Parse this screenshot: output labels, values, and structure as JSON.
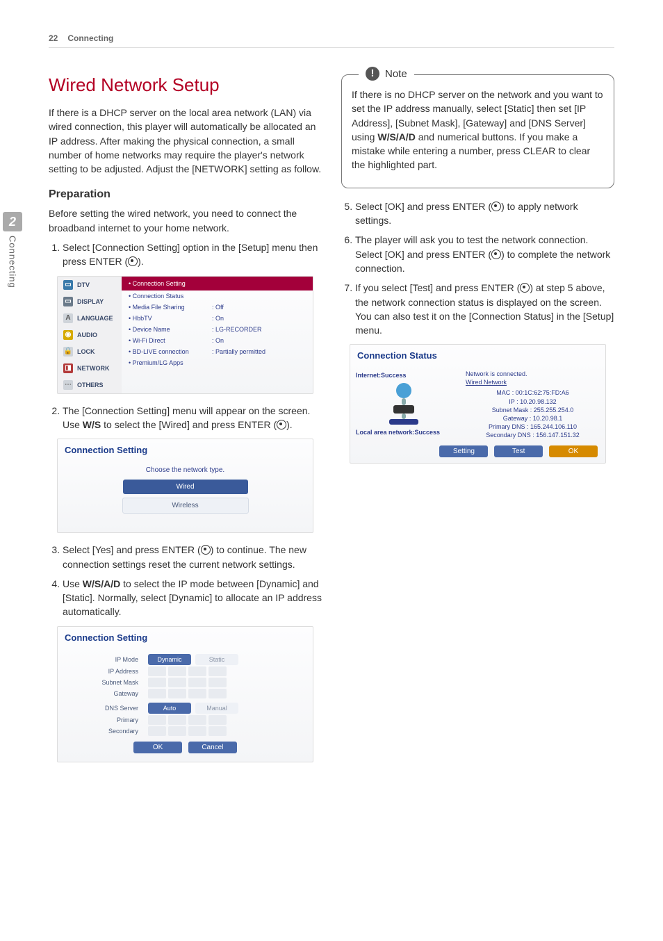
{
  "header": {
    "page_number": "22",
    "section": "Connecting"
  },
  "side_tab": {
    "number": "2",
    "label": "Connecting"
  },
  "left": {
    "title": "Wired Network Setup",
    "intro": "If there is a DHCP server on the local area network (LAN) via wired connection, this player will automatically be allocated an IP address. After making the physical connection, a small number of home networks may require the player's network setting to be adjusted. Adjust the [NETWORK] setting as follow.",
    "prep_heading": "Preparation",
    "prep_text": "Before setting the wired network, you need to connect the broadband internet to your home network.",
    "step1a": "Select [Connection Setting] option in the [Setup] menu then press ENTER (",
    "step1b": ").",
    "step2a": "The [Connection Setting] menu will appear on the screen. Use ",
    "step2_arrows": "W/S",
    "step2b": " to select the [Wired] and press ENTER (",
    "step2c": ").",
    "step3a": "Select [Yes] and press ENTER (",
    "step3b": ") to continue. The new connection settings reset the current network settings.",
    "step4a": "Use ",
    "step4_arrows": "W/S/A/D",
    "step4b": " to select the IP mode between [Dynamic] and [Static]. Normally, select [Dynamic] to allocate an IP address automatically."
  },
  "shot1": {
    "nav": [
      {
        "label": "DTV",
        "icon_bg": "#3a7aaa",
        "icon_txt": "▭"
      },
      {
        "label": "DISPLAY",
        "icon_bg": "#6a7a8a",
        "icon_txt": "▭"
      },
      {
        "label": "LANGUAGE",
        "icon_bg": "#cfd4da",
        "icon_txt": "A",
        "icon_fg": "#555"
      },
      {
        "label": "AUDIO",
        "icon_bg": "#d6aa00",
        "icon_txt": "◉"
      },
      {
        "label": "LOCK",
        "icon_bg": "#cfd4da",
        "icon_txt": "🔒",
        "icon_fg": "#7a6a3a"
      },
      {
        "label": "NETWORK",
        "icon_bg": "#b33a3a",
        "icon_txt": "◨"
      },
      {
        "label": "OTHERS",
        "icon_bg": "#cfd4da",
        "icon_txt": "⋯",
        "icon_fg": "#777"
      }
    ],
    "highlight": "• Connection Setting",
    "rows": [
      {
        "k": "• Connection Status",
        "v": ""
      },
      {
        "k": "• Media File Sharing",
        "v": ": Off"
      },
      {
        "k": "• HbbTV",
        "v": ": On"
      },
      {
        "k": "• Device Name",
        "v": ": LG-RECORDER"
      },
      {
        "k": "• Wi-Fi Direct",
        "v": ": On"
      },
      {
        "k": "• BD-LIVE connection",
        "v": ": Partially permitted"
      },
      {
        "k": "• Premium/LG Apps",
        "v": ""
      }
    ]
  },
  "shot2": {
    "title": "Connection Setting",
    "hint": "Choose the network type.",
    "opt_wired": "Wired",
    "opt_wireless": "Wireless"
  },
  "shot3": {
    "title": "Connection Setting",
    "labels": {
      "ip_mode": "IP Mode",
      "dynamic": "Dynamic",
      "static": "Static",
      "ip": "IP Address",
      "subnet": "Subnet Mask",
      "gateway": "Gateway",
      "dns": "DNS Server",
      "auto": "Auto",
      "manual": "Manual",
      "primary": "Primary",
      "secondary": "Secondary",
      "ok": "OK",
      "cancel": "Cancel"
    }
  },
  "right": {
    "note_heading": "Note",
    "note_a": "If there is no DHCP server on the network and you want to set the IP address manually, select [Static] then set [IP Address], [Subnet Mask], [Gateway] and [DNS Server] using ",
    "note_arrows": "W/S/A/D",
    "note_b": " and numerical buttons. If you make a mistake while entering a number, press CLEAR to clear the highlighted part.",
    "step5a": "Select [OK] and press ENTER (",
    "step5b": ") to apply network settings.",
    "step6a": "The player will ask you to test the network connection. Select [OK] and press ENTER (",
    "step6b": ") to complete the network connection.",
    "step7a": "If you select [Test] and press ENTER (",
    "step7b": ") at step 5 above, the network connection status is displayed on the screen.",
    "step7c": "You can also test it on the [Connection Status] in the [Setup] menu."
  },
  "shot4": {
    "title": "Connection Status",
    "internet": "Internet:Success",
    "lan": "Local area network:Success",
    "connected": "Network is connected.",
    "wired": "Wired Network",
    "lines": [
      "MAC : 00:1C:62:75:FD:A6",
      "IP : 10.20.98.132",
      "Subnet Mask : 255.255.254.0",
      "Gateway : 10.20.98.1",
      "Primary DNS : 165.244.106.110",
      "Secondary DNS : 156.147.151.32"
    ],
    "btn_setting": "Setting",
    "btn_test": "Test",
    "btn_ok": "OK"
  }
}
